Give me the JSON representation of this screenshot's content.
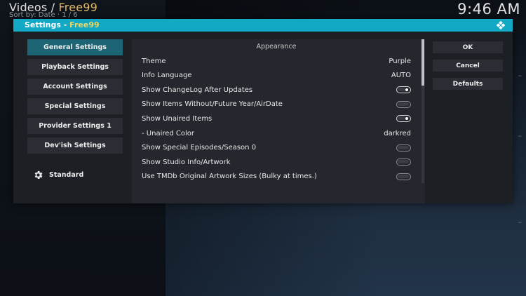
{
  "window": {
    "title_prefix": "Videos / ",
    "title_accent": "Free99",
    "sort_info": "Sort by: Date  ·  1 / 6",
    "clock": "9:46 AM"
  },
  "dialog": {
    "title_prefix": "Settings - ",
    "title_accent": "Free99",
    "logo_icon": "kodi-logo-icon",
    "accent_color": "#12a9c4"
  },
  "categories": [
    {
      "label": "General Settings",
      "active": true
    },
    {
      "label": "Playback Settings",
      "active": false
    },
    {
      "label": "Account Settings",
      "active": false
    },
    {
      "label": "Special Settings",
      "active": false
    },
    {
      "label": "Provider Settings 1",
      "active": false
    },
    {
      "label": "Dev'ish Settings",
      "active": false
    }
  ],
  "settings_level": {
    "icon": "gear-icon",
    "label": "Standard"
  },
  "settings_list": {
    "section": "Appearance",
    "rows": [
      {
        "label": "Theme",
        "type": "value",
        "value": "Purple"
      },
      {
        "label": "Info Language",
        "type": "value",
        "value": "AUTO"
      },
      {
        "label": "Show ChangeLog After Updates",
        "type": "toggle",
        "value": "on"
      },
      {
        "label": "Show Items Without/Future Year/AirDate",
        "type": "toggle",
        "value": "off"
      },
      {
        "label": "Show Unaired Items",
        "type": "toggle",
        "value": "on"
      },
      {
        "label": "- Unaired Color",
        "type": "value",
        "value": "darkred"
      },
      {
        "label": "Show Special Episodes/Season 0",
        "type": "toggle",
        "value": "off"
      },
      {
        "label": "Show Studio Info/Artwork",
        "type": "toggle",
        "value": "off"
      },
      {
        "label": "Use TMDb Original Artwork Sizes (Bulky at times.)",
        "type": "toggle",
        "value": "off"
      }
    ]
  },
  "actions": {
    "ok": "OK",
    "cancel": "Cancel",
    "defaults": "Defaults"
  }
}
